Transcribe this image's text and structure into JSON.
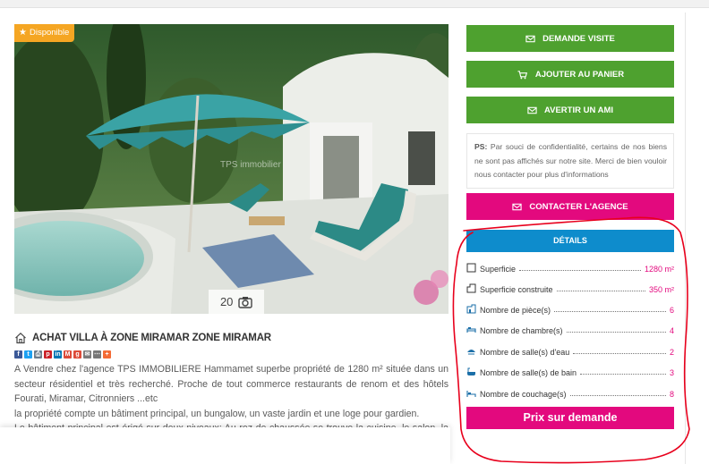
{
  "listing": {
    "badge": "Disponible",
    "photo_count": "20",
    "title": "ACHAT VILLA À ZONE MIRAMAR ZONE MIRAMAR",
    "watermark": "TPS immobilier",
    "description": [
      "A Vendre chez l'agence TPS IMMOBILIERE Hammamet superbe propriété de 1280 m² située dans un secteur résidentiel et très recherché. Proche de tout commerce restaurants de renom et des hôtels Fourati, Miramar, Citronniers ...etc",
      "la propriété compte un bâtiment principal, un bungalow, un vaste jardin et une loge pour gardien.",
      "Le bâtiment principal est érigé sur deux niveaux: Au rez de chaussée se trouve la cuisine, le salon, la salle"
    ]
  },
  "share_icons": [
    {
      "name": "facebook-icon",
      "color": "#3b5998",
      "glyph": "f"
    },
    {
      "name": "twitter-icon",
      "color": "#1da1f2",
      "glyph": "t"
    },
    {
      "name": "print-icon",
      "color": "#6d7b8a",
      "glyph": "⎙"
    },
    {
      "name": "pinterest-icon",
      "color": "#cb2027",
      "glyph": "p"
    },
    {
      "name": "linkedin-icon",
      "color": "#0077b5",
      "glyph": "in"
    },
    {
      "name": "gmail-icon",
      "color": "#dd4b39",
      "glyph": "M"
    },
    {
      "name": "google-icon",
      "color": "#dd4b39",
      "glyph": "g"
    },
    {
      "name": "email-icon",
      "color": "#7a7a7a",
      "glyph": "✉"
    },
    {
      "name": "more-icon",
      "color": "#777777",
      "glyph": "⋯"
    },
    {
      "name": "plus-icon",
      "color": "#f46b35",
      "glyph": "+"
    }
  ],
  "actions": {
    "visit": "DEMANDE VISITE",
    "cart": "AJOUTER AU PANIER",
    "friend": "AVERTIR UN AMI",
    "contact": "CONTACTER L'AGENCE"
  },
  "ps": {
    "label": "PS:",
    "text": " Par souci de confidentialité, certains de nos biens ne sont pas affichés sur notre site. Merci de bien vouloir nous contacter pour plus d'informations"
  },
  "details": {
    "header": "DÉTAILS",
    "rows": [
      {
        "icon": "area-icon",
        "label": "Superficie",
        "value": "1280 m²"
      },
      {
        "icon": "built-area-icon",
        "label": "Superficie construite",
        "value": "350 m²"
      },
      {
        "icon": "rooms-icon",
        "label": "Nombre de pièce(s)",
        "value": "6"
      },
      {
        "icon": "bedroom-icon",
        "label": "Nombre de chambre(s)",
        "value": "4"
      },
      {
        "icon": "shower-icon",
        "label": "Nombre de salle(s) d'eau",
        "value": "2"
      },
      {
        "icon": "bath-icon",
        "label": "Nombre de salle(s) de bain",
        "value": "3"
      },
      {
        "icon": "bed-icon",
        "label": "Nombre de couchage(s)",
        "value": "8"
      }
    ],
    "price": "Prix sur demande"
  },
  "colors": {
    "green": "#4ea12f",
    "pink": "#e3097e",
    "blue": "#0e8ccc",
    "badge": "#f5a623",
    "annotation": "#e8001c"
  }
}
